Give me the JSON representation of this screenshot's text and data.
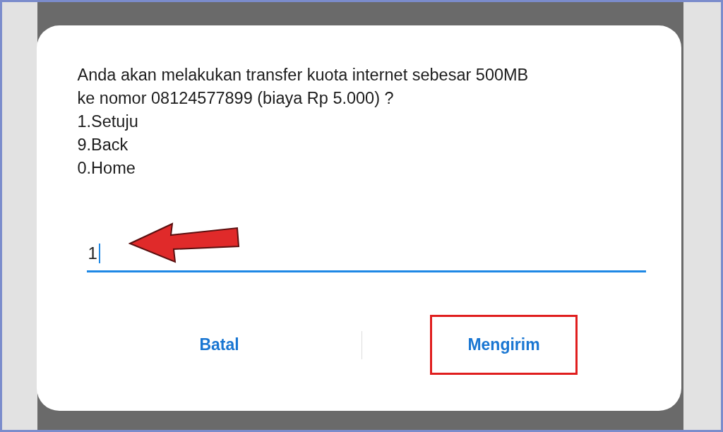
{
  "dialog": {
    "message_lines": [
      "Anda akan melakukan transfer kuota internet sebesar 500MB",
      "ke nomor 08124577899 (biaya Rp 5.000) ?",
      "1.Setuju",
      "9.Back",
      "0.Home"
    ],
    "input": {
      "value": "1"
    },
    "buttons": [
      {
        "label": "Batal",
        "highlighted": false
      },
      {
        "label": "Mengirim",
        "highlighted": true
      }
    ]
  }
}
